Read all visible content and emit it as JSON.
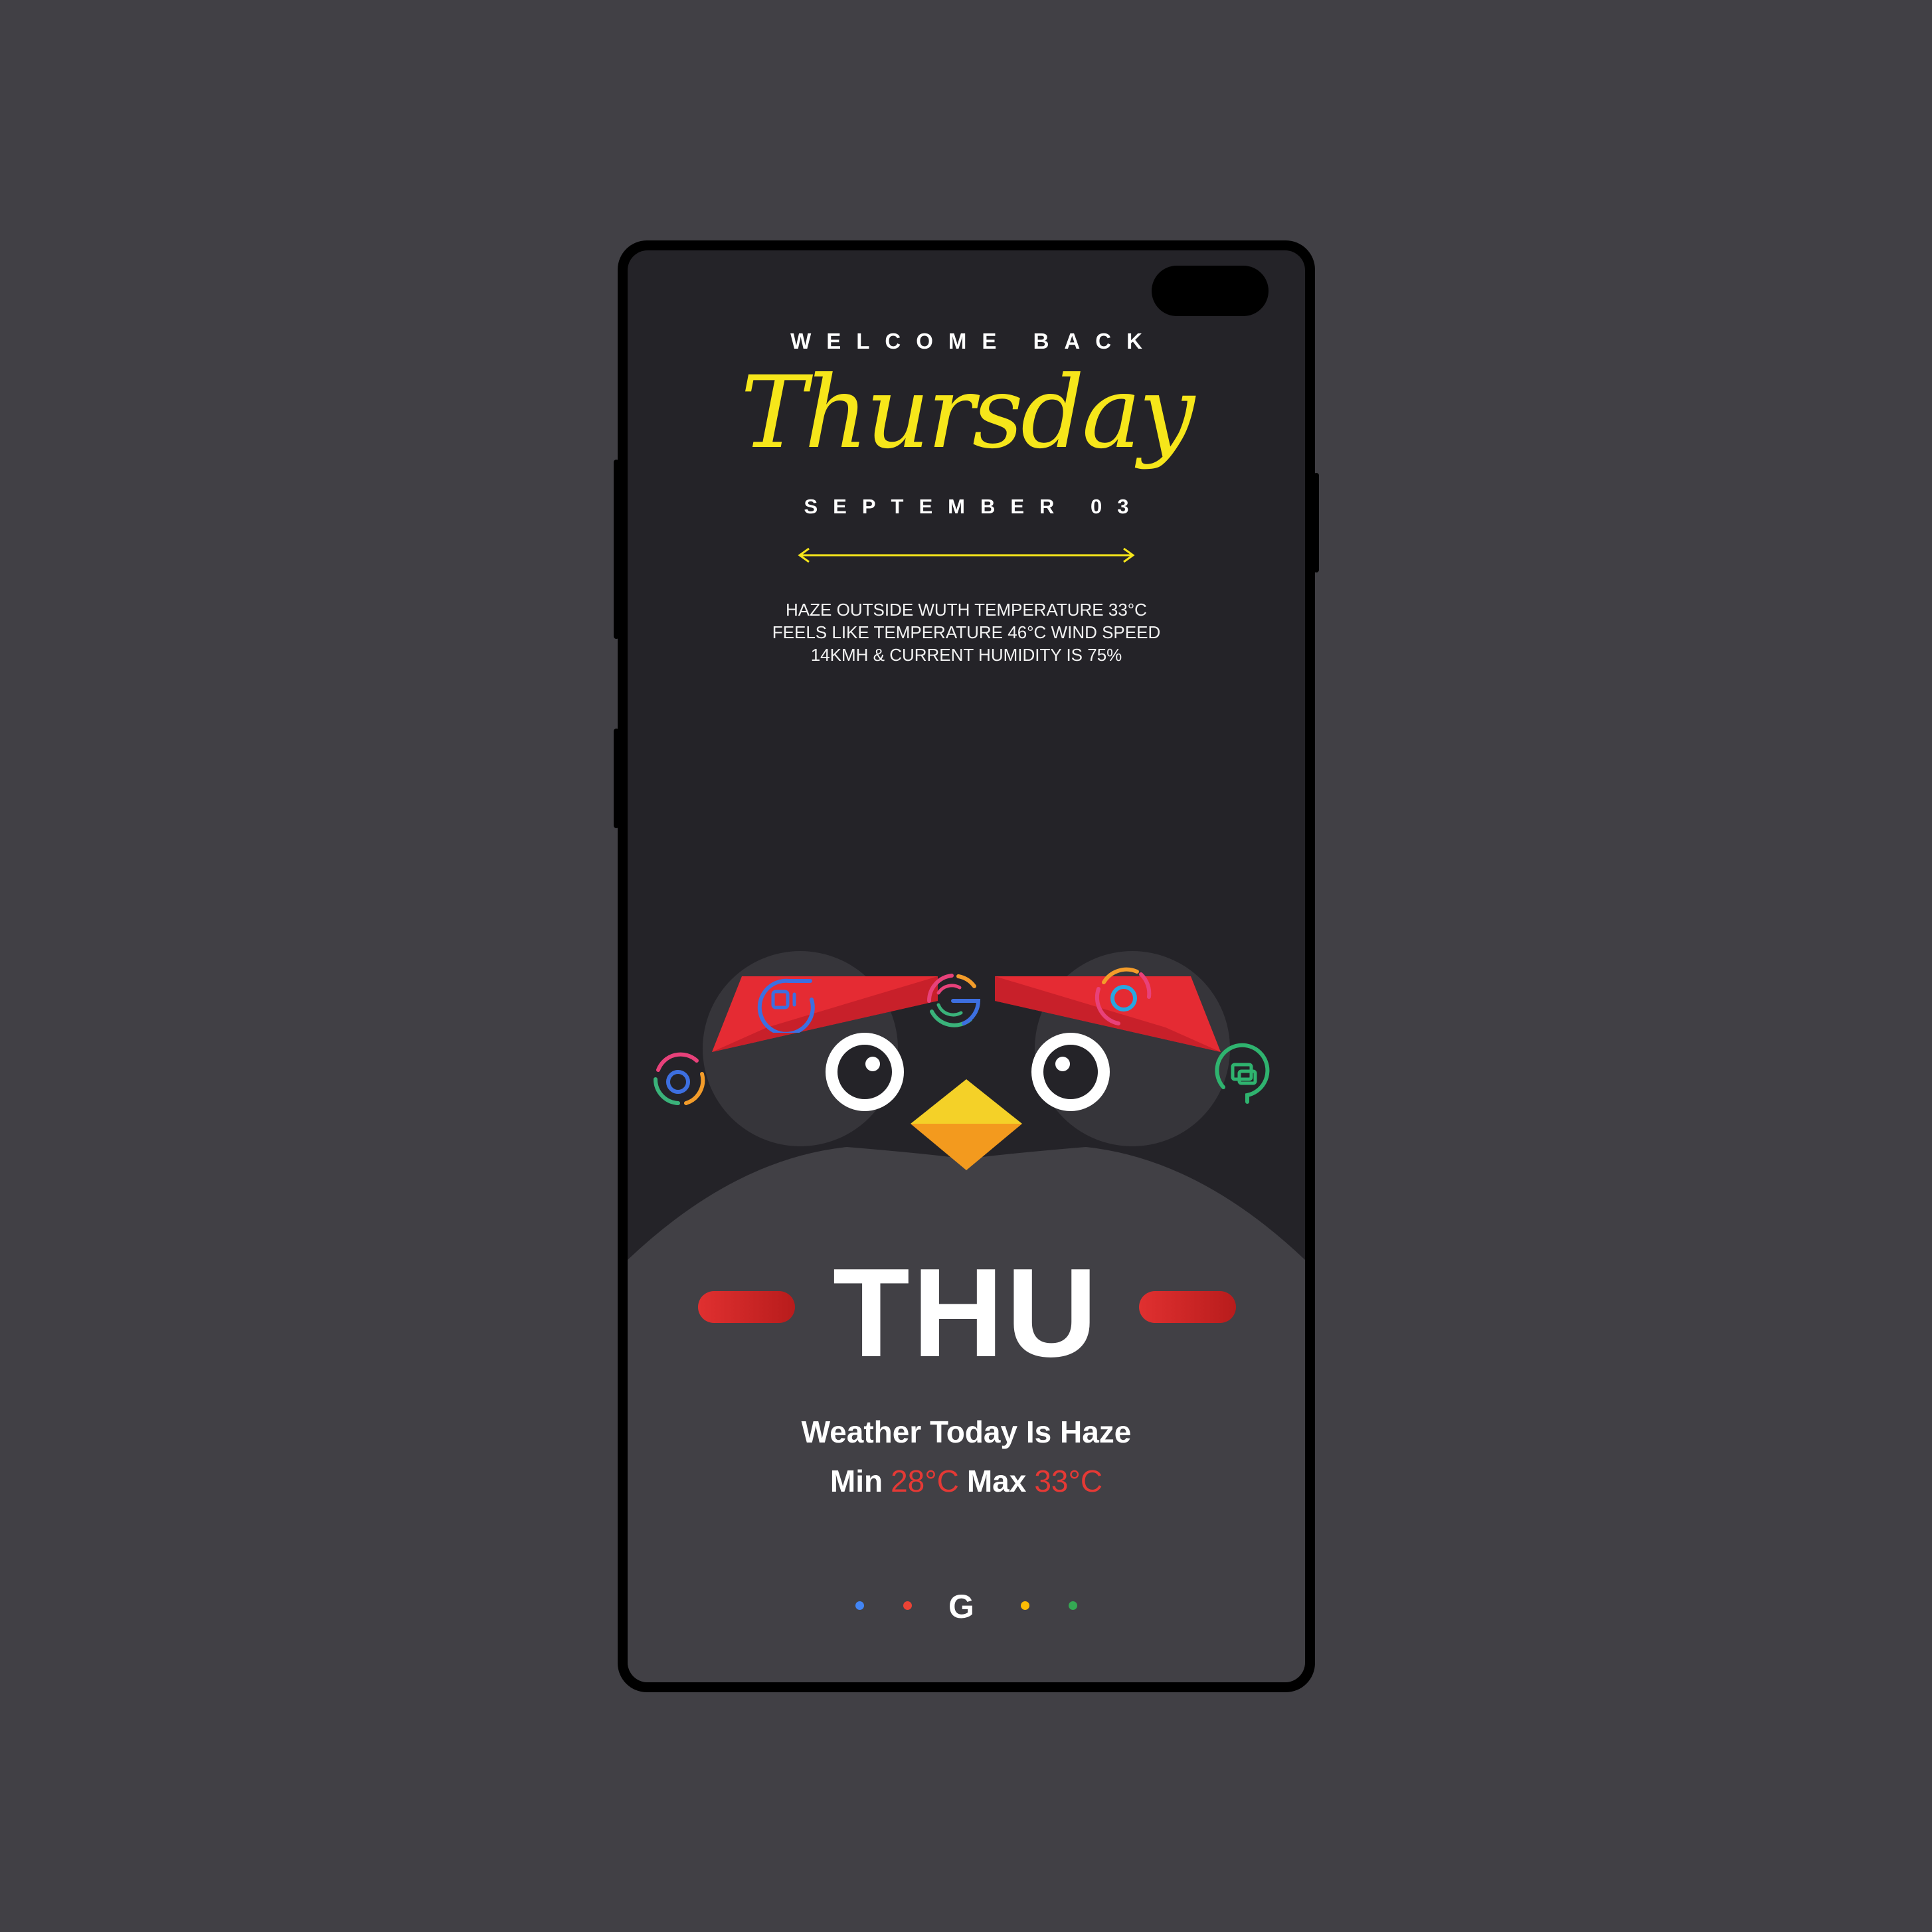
{
  "header": {
    "welcome": "WELCOME BACK",
    "day_script": "Thursday",
    "date": "SEPTEMBER 03"
  },
  "weather": {
    "line1": "HAZE OUTSIDE WUTH TEMPERATURE 33°C",
    "line2": "FEELS LIKE TEMPERATURE 46°C WIND SPEED",
    "line3": "14KMH & CURRENT HUMIDITY IS 75%"
  },
  "apps": [
    {
      "icon": "screen-recorder-icon",
      "color": "#3d6fe0"
    },
    {
      "icon": "google-icon",
      "color": "#e8417a"
    },
    {
      "icon": "camera-icon",
      "color": "#f39c2a"
    },
    {
      "icon": "chrome-icon",
      "color": "#3ab27a"
    },
    {
      "icon": "messages-icon",
      "color": "#2fb36f"
    }
  ],
  "day_widget": {
    "day_short": "THU",
    "weather_today": "Weather Today Is Haze",
    "min_label": "Min",
    "min_value": "28°C",
    "max_label": "Max",
    "max_value": "33°C"
  },
  "search_bar": {
    "logo": "G",
    "dot_colors": [
      "#4285f4",
      "#ea4335",
      "#fbbc05",
      "#34a853"
    ]
  },
  "colors": {
    "accent_yellow": "#f6e61a",
    "accent_red": "#e53935",
    "background": "#414045",
    "screen": "#242328"
  }
}
